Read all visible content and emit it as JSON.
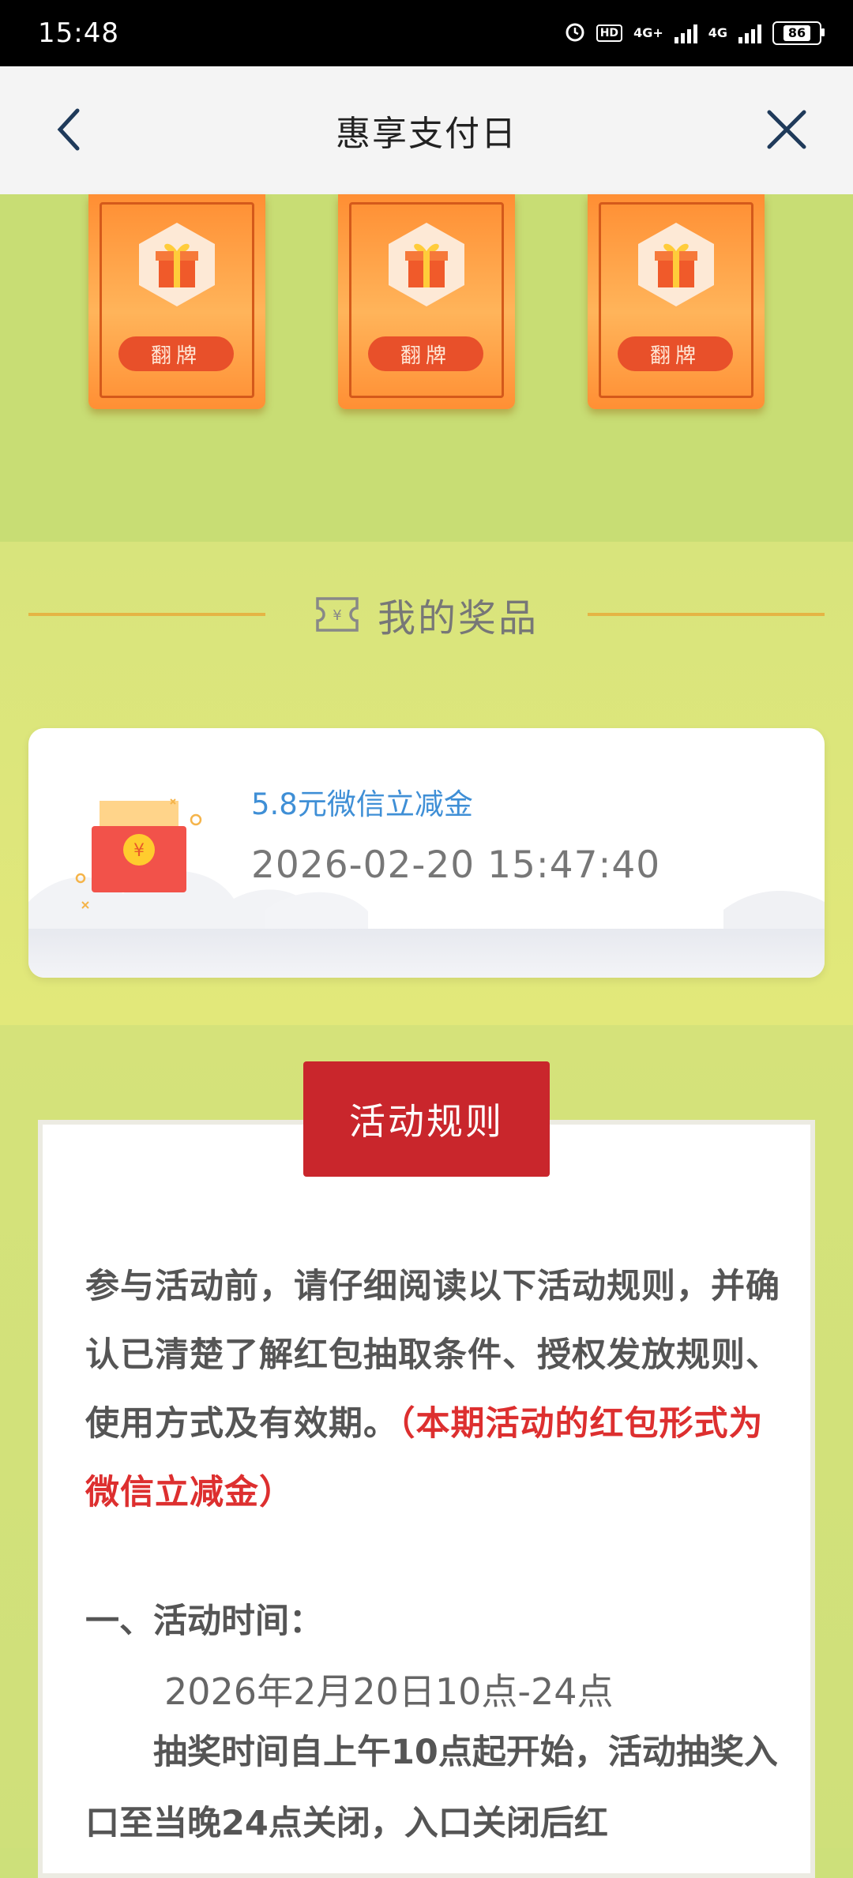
{
  "status_bar": {
    "time": "15:48",
    "hd_label": "HD",
    "net1": "4G+",
    "net2": "4G",
    "battery": "86"
  },
  "nav": {
    "title": "惠享支付日"
  },
  "flip_cards": [
    {
      "button": "翻牌"
    },
    {
      "button": "翻牌"
    },
    {
      "button": "翻牌"
    }
  ],
  "prizes": {
    "heading": "我的奖品",
    "items": [
      {
        "name": "5.8元微信立减金",
        "time": "2026-02-20 15:47:40"
      }
    ]
  },
  "rules": {
    "tab": "活动规则",
    "intro": "参与活动前，请仔细阅读以下活动规则，并确认已清楚了解红包抽取条件、授权发放规则、使用方式及有效期。",
    "intro_red": "（本期活动的红包形式为微信立减金）",
    "section1_heading": "一、活动时间：",
    "section1_date": "2026年2月20日10点-24点",
    "section1_text": "抽奖时间自上午10点起开始，活动抽奖入口至当晚24点关闭，入口关闭后红"
  },
  "colors": {
    "accent_red": "#c9262c",
    "prize_blue": "#3f8fd6",
    "card_orange": "#ff8e33",
    "background_green": "#cde07a"
  }
}
